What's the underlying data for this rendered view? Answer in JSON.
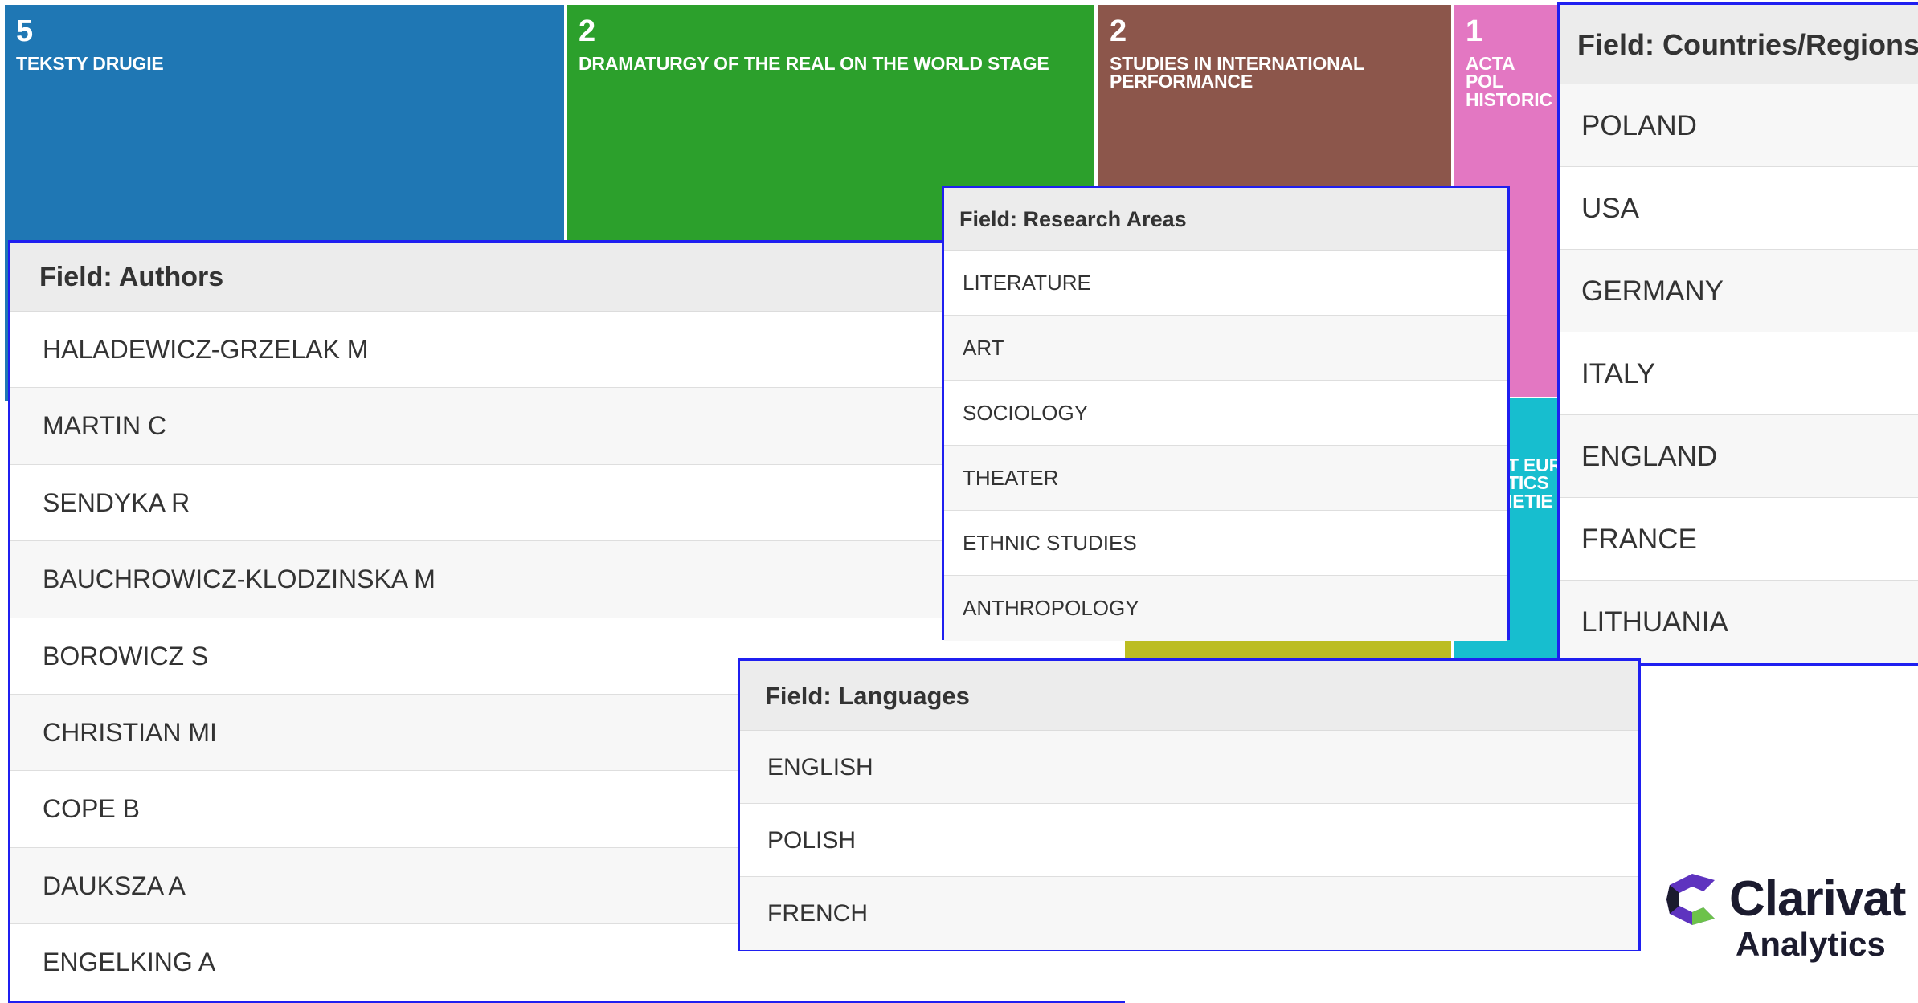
{
  "treemap": {
    "tiles": [
      {
        "count": "5",
        "name": "TEKSTY DRUGIE",
        "color": "#1f77b4"
      },
      {
        "count": "2",
        "name": "DRAMATURGY OF THE REAL ON THE WORLD STAGE",
        "color": "#2ca02c"
      },
      {
        "count": "2",
        "name": "STUDIES IN INTERNATIONAL PERFORMANCE",
        "color": "#8c564b"
      },
      {
        "count": "1",
        "name": "ACTA POL HISTORIC",
        "color": "#e377c2"
      },
      {
        "count": "",
        "name": "T EUR TICS IETIE",
        "color": "#17becf"
      },
      {
        "count": "",
        "name": "",
        "color": "#bcbd22"
      }
    ]
  },
  "panels": {
    "authors": {
      "header": "Field: Authors",
      "items": [
        "HALADEWICZ-GRZELAK M",
        "MARTIN C",
        "SENDYKA R",
        "BAUCHROWICZ-KLODZINSKA M",
        "BOROWICZ S",
        "CHRISTIAN MI",
        "COPE B",
        "DAUKSZA A",
        "ENGELKING A"
      ]
    },
    "research_areas": {
      "header": "Field: Research Areas",
      "items": [
        "LITERATURE",
        "ART",
        "SOCIOLOGY",
        "THEATER",
        "ETHNIC STUDIES",
        "ANTHROPOLOGY"
      ]
    },
    "countries": {
      "header": "Field: Countries/Regions",
      "items": [
        "POLAND",
        "USA",
        "GERMANY",
        "ITALY",
        "ENGLAND",
        "FRANCE",
        "LITHUANIA"
      ]
    },
    "languages": {
      "header": "Field: Languages",
      "items": [
        "ENGLISH",
        "POLISH",
        "FRENCH"
      ]
    }
  },
  "logo": {
    "brand": "Clarivat",
    "sub": "Analytics",
    "colors": {
      "purple": "#5e33bf",
      "green": "#6cc24a"
    }
  },
  "colors": {
    "panel_border": "#1f1ff0",
    "header_bg": "#ececec"
  }
}
